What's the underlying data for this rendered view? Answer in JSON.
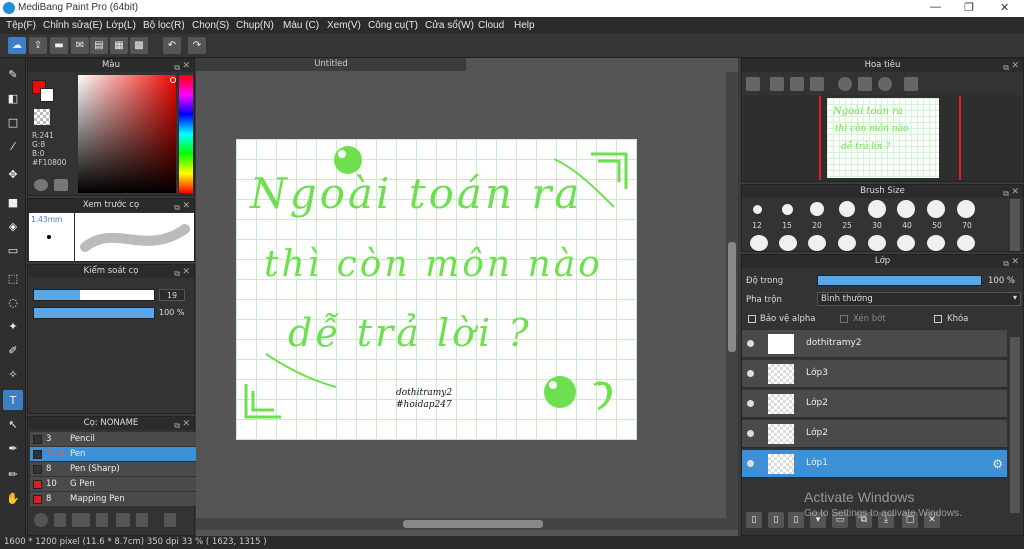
{
  "window": {
    "title": "MediBang Paint Pro (64bit)",
    "min": "—",
    "max": "❐",
    "close": "✕"
  },
  "menu": [
    "Tệp(F)",
    "Chỉnh sửa(E)",
    "Lớp(L)",
    "Bộ lọc(R)",
    "Chọn(S)",
    "Chụp(N)",
    "Màu (C)",
    "Xem(V)",
    "Công cụ(T)",
    "Cửa sổ(W)",
    "Cloud",
    "Help"
  ],
  "color_panel": {
    "title": "Màu",
    "r": "R:241",
    "g": "G:8",
    "b": "B:0",
    "hex": "#F10800",
    "primary": "#F10800"
  },
  "preview_panel": {
    "title": "Xem trước cọ",
    "size": "1.43mm"
  },
  "control_panel": {
    "title": "Kiểm soát cọ",
    "size_value": "19",
    "opacity_value": "100 %"
  },
  "brush_panel": {
    "title": "Cọ: NONAME",
    "items": [
      {
        "size": "3",
        "name": "Pencil",
        "color": "#333333"
      },
      {
        "size": "11.4",
        "name": "Pen",
        "color": "#333333"
      },
      {
        "size": "8",
        "name": "Pen (Sharp)",
        "color": "#333333"
      },
      {
        "size": "10",
        "name": "G Pen",
        "color": "#e02020"
      },
      {
        "size": "8",
        "name": "Mapping Pen",
        "color": "#e02020"
      }
    ]
  },
  "document": {
    "tab": "Untitled"
  },
  "artwork": {
    "line1": "Ngoài toán ra",
    "line2": "thì còn môn nào",
    "line3": "dễ trả lời ?",
    "sig1": "dothitramy2",
    "sig2": "#hoidap247",
    "ink": "#6ee04f"
  },
  "navigator": {
    "title": "Hoa tiêu"
  },
  "brush_size": {
    "title": "Brush Size",
    "sizes": [
      "12",
      "15",
      "20",
      "25",
      "30",
      "40",
      "50",
      "70"
    ]
  },
  "layer_panel": {
    "title": "Lớp",
    "opacity_label": "Độ trong",
    "opacity_value": "100 %",
    "opacity_fraction": 1.0,
    "blend_label": "Pha trộn",
    "blend_value": "Bình thường",
    "protect_alpha": "Bảo vệ alpha",
    "clipping": "Xén bớt",
    "lock": "Khóa",
    "layers": [
      "dothitramy2",
      "Lớp3",
      "Lớp2",
      "Lớp2",
      "Lớp1"
    ]
  },
  "watermark": {
    "line1": "Activate Windows",
    "line2": "Go to Settings to activate Windows."
  },
  "status": {
    "text": "1600 * 1200 pixel   (11.6 * 8.7cm)   350 dpi   33 %   ( 1623, 1315 )"
  }
}
